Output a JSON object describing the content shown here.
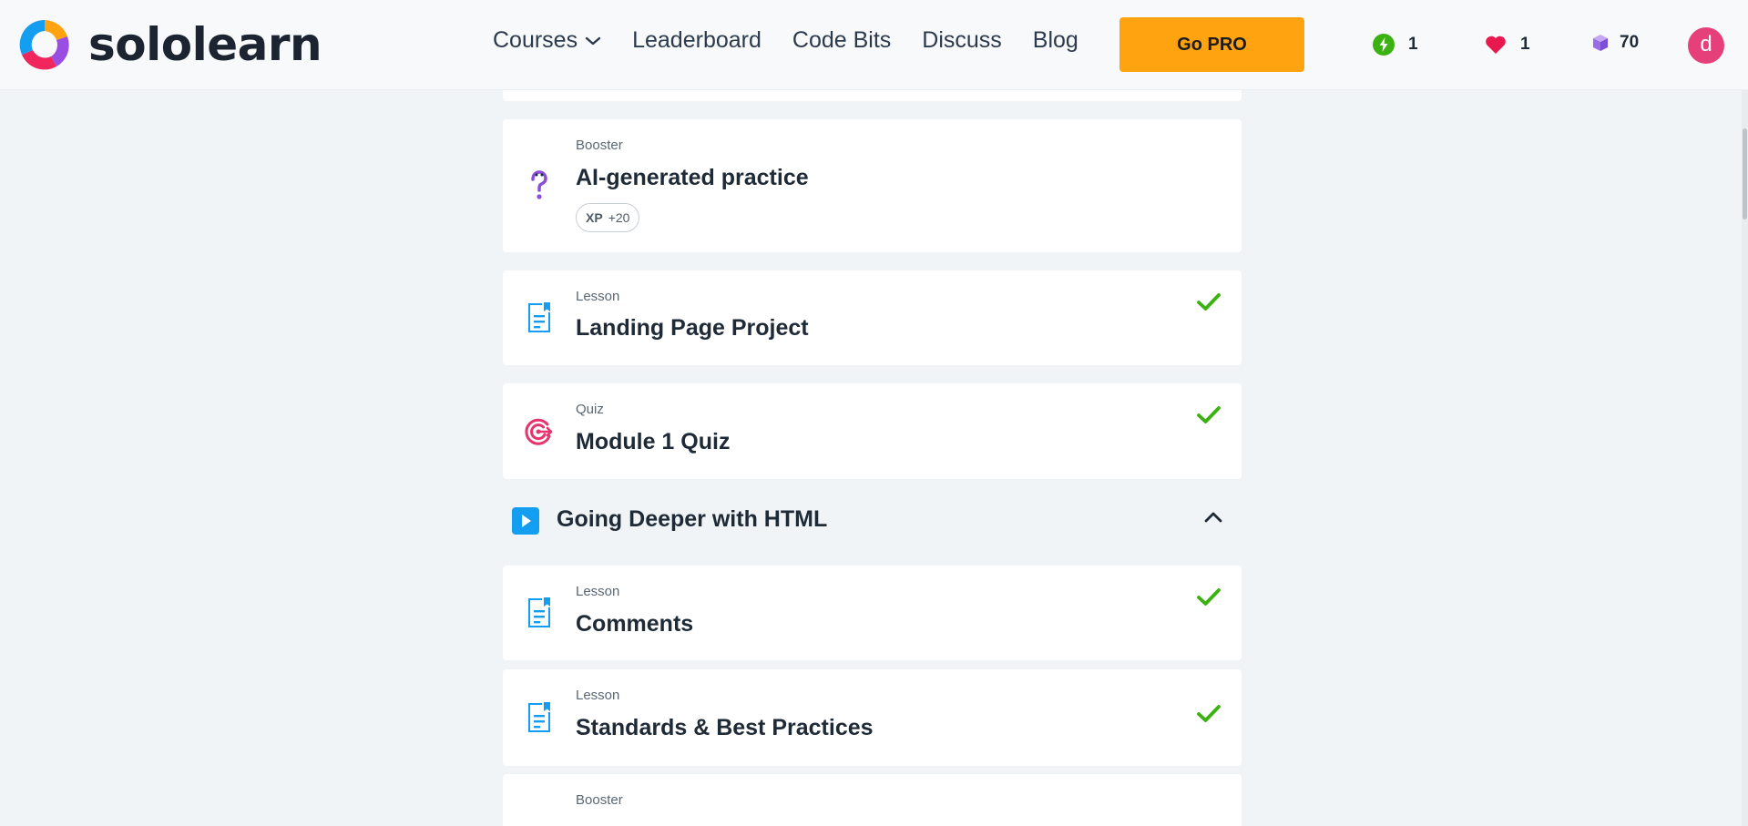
{
  "brand": {
    "name": "sololearn",
    "colors": {
      "accent_orange": "#ffa311",
      "logo_blue": "#149ef2",
      "logo_orange": "#ffa311",
      "logo_pink": "#f1265d",
      "logo_purple": "#9a4de3",
      "check_green": "#3cb212",
      "lesson_blue": "#149ef2",
      "quiz_red": "#e8336c",
      "avatar_pink": "#e5407a"
    }
  },
  "nav": {
    "courses": "Courses",
    "leaderboard": "Leaderboard",
    "code_bits": "Code Bits",
    "discuss": "Discuss",
    "blog": "Blog"
  },
  "header": {
    "pro_label": "Go PRO",
    "streak": "1",
    "hearts": "1",
    "bits": "70",
    "avatar_letter": "d"
  },
  "items": [
    {
      "kind": "Booster",
      "title": "AI-generated practice",
      "icon": "question-mark-icon",
      "xp_label": "XP",
      "xp_value": "+20",
      "completed": false
    },
    {
      "kind": "Lesson",
      "title": "Landing Page Project",
      "icon": "lesson-icon",
      "completed": true
    },
    {
      "kind": "Quiz",
      "title": "Module 1 Quiz",
      "icon": "target-icon",
      "completed": true
    }
  ],
  "section": {
    "title": "Going Deeper with HTML",
    "icon": "play-icon",
    "expanded": true
  },
  "section_items": [
    {
      "kind": "Lesson",
      "title": "Comments",
      "icon": "lesson-icon",
      "completed": true
    },
    {
      "kind": "Lesson",
      "title": "Standards & Best Practices",
      "icon": "lesson-icon",
      "completed": true
    },
    {
      "kind": "Booster",
      "title": "",
      "icon": "question-mark-icon",
      "completed": false
    }
  ]
}
